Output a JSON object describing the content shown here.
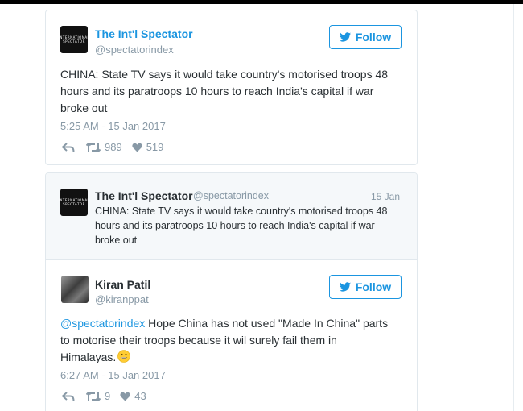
{
  "tweet1": {
    "display_name": "The Int'l Spectator",
    "handle": "@spectatorindex",
    "avatar_text": [
      "INTERNATIONAL",
      "SPECTATOR"
    ],
    "follow_label": "Follow",
    "text": "CHINA: State TV says it would take country's motorised troops 48 hours and its paratroops 10 hours to reach India's capital if war broke out",
    "timestamp": "5:25 AM - 15 Jan 2017",
    "retweets": "989",
    "likes": "519"
  },
  "quoted_tweet": {
    "display_name": "The Int'l Spectator",
    "handle": "@spectatorindex",
    "avatar_text": [
      "INTERNATIONAL",
      "SPECTATOR"
    ],
    "date": "15 Jan",
    "text": "CHINA: State TV says it would take country's motorised troops 48 hours and its paratroops 10 hours to reach India's capital if war broke out"
  },
  "tweet2": {
    "display_name": "Kiran Patil",
    "handle": "@kiranppat",
    "follow_label": "Follow",
    "mention": "@spectatorindex",
    "text": " Hope China has not used \"Made In China\" parts to motorise their troops because it wil surely fail them in Himalayas.",
    "emoji": "grinning-face",
    "timestamp": "6:27 AM - 15 Jan 2017",
    "retweets": "9",
    "likes": "43"
  },
  "colors": {
    "accent": "#1b95e0",
    "muted": "#8899a6",
    "text": "#292f33",
    "border": "#e1e8ed",
    "quote_bg": "#f5f8fa"
  }
}
